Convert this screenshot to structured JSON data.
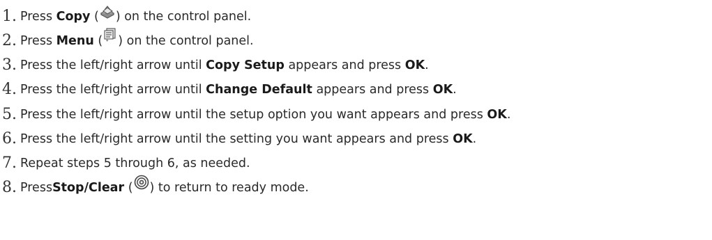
{
  "steps": [
    {
      "number": "1.",
      "parts": [
        "Press ",
        "Copy",
        " (",
        ") on the control panel."
      ],
      "icon": "copy-icon"
    },
    {
      "number": "2.",
      "parts": [
        "Press ",
        "Menu",
        " (",
        ") on the control panel."
      ],
      "icon": "menu-icon"
    },
    {
      "number": "3.",
      "parts": [
        "Press the left/right arrow until ",
        "Copy Setup",
        " appears and press ",
        "OK",
        "."
      ]
    },
    {
      "number": "4.",
      "parts": [
        "Press the left/right arrow until ",
        "Change Default",
        " appears and press ",
        "OK",
        "."
      ]
    },
    {
      "number": "5.",
      "parts": [
        "Press the left/right arrow until the setup option you want appears and press ",
        "OK",
        "."
      ]
    },
    {
      "number": "6.",
      "parts": [
        "Press the left/right arrow until the setting you want appears and press ",
        "OK",
        "."
      ]
    },
    {
      "number": "7.",
      "parts": [
        "Repeat steps 5 through 6, as needed."
      ]
    },
    {
      "number": "8.",
      "parts": [
        "Press",
        "Stop/Clear",
        " (",
        ") to return to ready mode."
      ],
      "icon": "stop-clear-icon"
    }
  ]
}
